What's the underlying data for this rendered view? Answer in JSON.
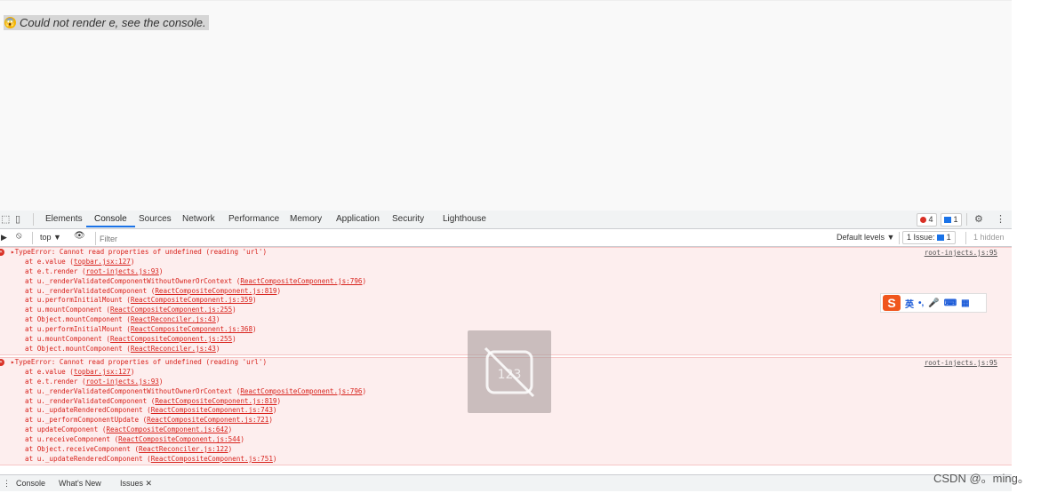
{
  "page": {
    "error_text": "Could not render e, see the console."
  },
  "devtools": {
    "tabs": [
      "Elements",
      "Console",
      "Sources",
      "Network",
      "Performance",
      "Memory",
      "Application",
      "Security",
      "Lighthouse"
    ],
    "active_tab": "Console",
    "errors_count": "4",
    "messages_count": "1",
    "context_label": "top ▼",
    "filter_placeholder": "Filter",
    "default_levels": "Default levels ▼",
    "issues_label": "1 Issue:",
    "issues_count": "1",
    "hidden_label": "1 hidden"
  },
  "console": {
    "messages": [
      {
        "head": "▸TypeError: Cannot read properties of undefined (reading 'url')",
        "source": "root-injects.js:95",
        "frames": [
          [
            "at e.value (",
            "topbar.jsx:127",
            ")"
          ],
          [
            "at e.t.render (",
            "root-injects.js:93",
            ")"
          ],
          [
            "at u._renderValidatedComponentWithoutOwnerOrContext (",
            "ReactCompositeComponent.js:796",
            ")"
          ],
          [
            "at u._renderValidatedComponent (",
            "ReactCompositeComponent.js:819",
            ")"
          ],
          [
            "at u.performInitialMount (",
            "ReactCompositeComponent.js:359",
            ")"
          ],
          [
            "at u.mountComponent (",
            "ReactCompositeComponent.js:255",
            ")"
          ],
          [
            "at Object.mountComponent (",
            "ReactReconciler.js:43",
            ")"
          ],
          [
            "at u.performInitialMount (",
            "ReactCompositeComponent.js:368",
            ")"
          ],
          [
            "at u.mountComponent (",
            "ReactCompositeComponent.js:255",
            ")"
          ],
          [
            "at Object.mountComponent (",
            "ReactReconciler.js:43",
            ")"
          ]
        ]
      },
      {
        "head": "▸TypeError: Cannot read properties of undefined (reading 'url')",
        "source": "root-injects.js:95",
        "frames": [
          [
            "at e.value (",
            "topbar.jsx:127",
            ")"
          ],
          [
            "at e.t.render (",
            "root-injects.js:93",
            ")"
          ],
          [
            "at u._renderValidatedComponentWithoutOwnerOrContext (",
            "ReactCompositeComponent.js:796",
            ")"
          ],
          [
            "at u._renderValidatedComponent (",
            "ReactCompositeComponent.js:819",
            ")"
          ],
          [
            "at u._updateRenderedComponent (",
            "ReactCompositeComponent.js:743",
            ")"
          ],
          [
            "at u._performComponentUpdate (",
            "ReactCompositeComponent.js:721",
            ")"
          ],
          [
            "at updateComponent (",
            "ReactCompositeComponent.js:642",
            ")"
          ],
          [
            "at u.receiveComponent (",
            "ReactCompositeComponent.js:544",
            ")"
          ],
          [
            "at Object.receiveComponent (",
            "ReactReconciler.js:122",
            ")"
          ],
          [
            "at u._updateRenderedComponent (",
            "ReactCompositeComponent.js:751",
            ")"
          ]
        ]
      }
    ]
  },
  "drawer": {
    "tabs": [
      "Console",
      "What's New",
      "Issues ✕"
    ]
  },
  "ime": {
    "lang": "英",
    "punct": "•,",
    "mic": "🎤",
    "keyboard": "⌨",
    "grid": "▦"
  },
  "watermark": "CSDN @。ming。",
  "colors": {
    "error_red": "#d8221c",
    "error_bg": "#fdeeee",
    "accent_blue": "#1a73e8"
  }
}
